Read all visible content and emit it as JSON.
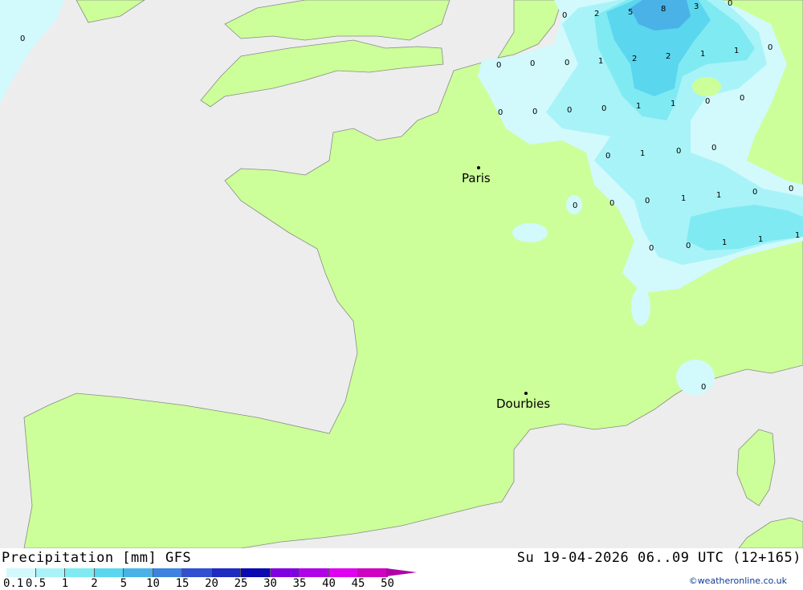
{
  "map": {
    "land_color": "#ccff99",
    "sea_color": "#ededed",
    "cities": [
      {
        "name": "Paris"
      },
      {
        "name": "Dourbies"
      }
    ],
    "values": [
      "0",
      "2",
      "5",
      "8",
      "3",
      "0",
      "0",
      "0",
      "0",
      "0",
      "1",
      "2",
      "2",
      "1",
      "1",
      "0",
      "0",
      "0",
      "0",
      "0",
      "1",
      "1",
      "0",
      "0",
      "0",
      "1",
      "0",
      "0",
      "0",
      "0",
      "0",
      "1",
      "1",
      "0",
      "0",
      "0",
      "0",
      "1",
      "1",
      "1",
      "0",
      "0"
    ]
  },
  "legend": {
    "title": "Precipitation [mm] GFS",
    "time": "Su 19-04-2026 06..09 UTC (12+165)",
    "ticks": [
      "0.1",
      "0.5",
      "1",
      "2",
      "5",
      "10",
      "15",
      "20",
      "25",
      "30",
      "35",
      "40",
      "45",
      "50"
    ],
    "colors": [
      "#d2f9fc",
      "#a8f3f8",
      "#80eaf2",
      "#5ad6ee",
      "#4ab2e6",
      "#3c82de",
      "#3050d0",
      "#1f2ac0",
      "#0a0ab0",
      "#8000e0",
      "#b000e8",
      "#e000f0",
      "#d000c0",
      "#b000a8"
    ]
  },
  "credit": "©weatheronline.co.uk"
}
